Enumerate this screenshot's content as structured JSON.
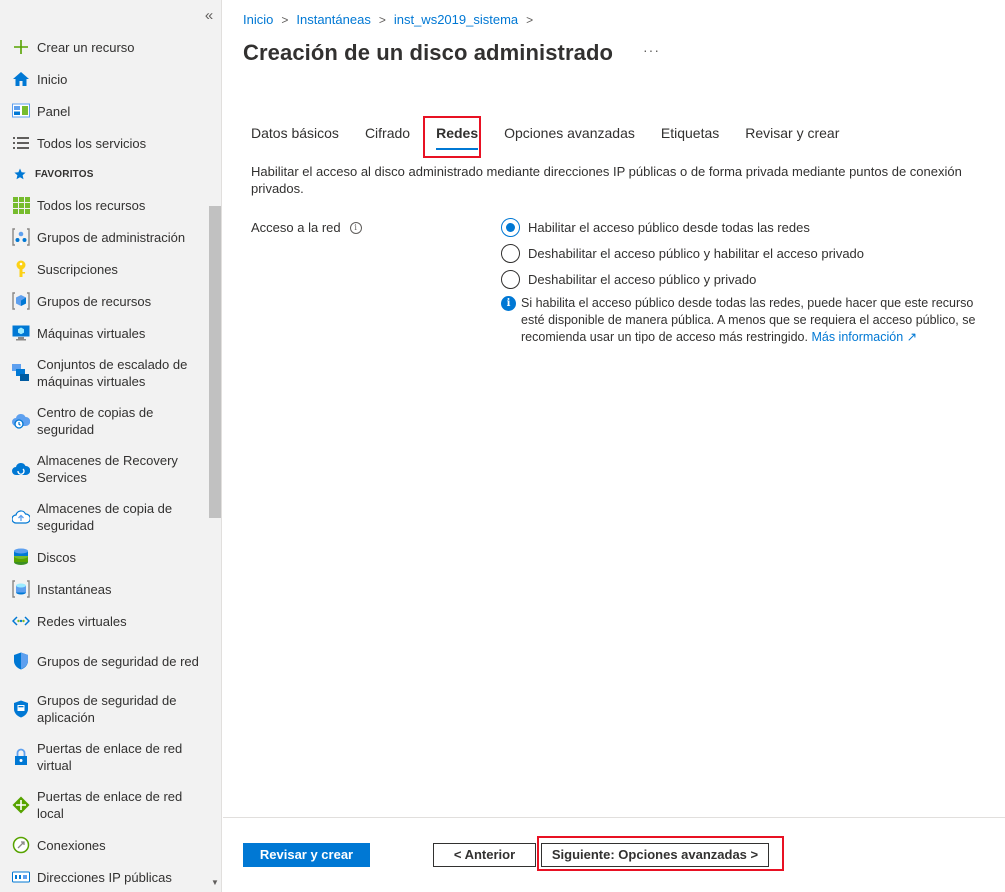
{
  "sidebar": {
    "collapse_symbol": "«",
    "create": {
      "label": "Crear un recurso",
      "icon": "plus-icon"
    },
    "items_top": [
      {
        "label": "Inicio",
        "icon": "home-icon"
      },
      {
        "label": "Panel",
        "icon": "dashboard-icon"
      },
      {
        "label": "Todos los servicios",
        "icon": "list-icon"
      }
    ],
    "favorites_label": "FAVORITOS",
    "favorites": [
      {
        "label": "Todos los recursos",
        "icon": "grid-icon"
      },
      {
        "label": "Grupos de administración",
        "icon": "management-group-icon"
      },
      {
        "label": "Suscripciones",
        "icon": "key-icon"
      },
      {
        "label": "Grupos de recursos",
        "icon": "cube-icon"
      },
      {
        "label": "Máquinas virtuales",
        "icon": "monitor-icon"
      },
      {
        "label": "Conjuntos de escalado de máquinas virtuales",
        "icon": "scale-set-icon"
      },
      {
        "label": "Centro de copias de seguridad",
        "icon": "backup-center-icon"
      },
      {
        "label": "Almacenes de Recovery Services",
        "icon": "recovery-cloud-icon"
      },
      {
        "label": "Almacenes de copia de seguridad",
        "icon": "backup-cloud-icon"
      },
      {
        "label": "Discos",
        "icon": "disk-icon"
      },
      {
        "label": "Instantáneas",
        "icon": "snapshot-icon"
      },
      {
        "label": "Redes virtuales",
        "icon": "vnet-icon"
      },
      {
        "label": "Grupos de seguridad de red",
        "icon": "shield-icon"
      },
      {
        "label": "Grupos de seguridad de aplicación",
        "icon": "app-shield-icon"
      },
      {
        "label": "Puertas de enlace de red virtual",
        "icon": "gateway-lock-icon"
      },
      {
        "label": "Puertas de enlace de red local",
        "icon": "gateway-diamond-icon"
      },
      {
        "label": "Conexiones",
        "icon": "connection-icon"
      },
      {
        "label": "Direcciones IP públicas",
        "icon": "public-ip-icon"
      }
    ]
  },
  "breadcrumb": [
    "Inicio",
    "Instantáneas",
    "inst_ws2019_sistema"
  ],
  "page": {
    "title": "Creación de un disco administrado",
    "more": "···"
  },
  "tabs": [
    "Datos básicos",
    "Cifrado",
    "Redes",
    "Opciones avanzadas",
    "Etiquetas",
    "Revisar y crear"
  ],
  "active_tab": "Redes",
  "description": "Habilitar el acceso al disco administrado mediante direcciones IP públicas o de forma privada mediante puntos de conexión privados.",
  "network_access": {
    "label": "Acceso a la red",
    "info_symbol": "i",
    "options": [
      "Habilitar el acceso público desde todas las redes",
      "Deshabilitar el acceso público y habilitar el acceso privado",
      "Deshabilitar el acceso público y privado"
    ],
    "selected_index": 0,
    "info_message": "Si habilita el acceso público desde todas las redes, puede hacer que este recurso esté disponible de manera pública. A menos que se requiera el acceso público, se recomienda usar un tipo de acceso más restringido.",
    "info_link": "Más información",
    "external_link_symbol": "↗"
  },
  "footer": {
    "review_create": "Revisar y crear",
    "previous": "< Anterior",
    "next": "Siguiente: Opciones avanzadas >"
  },
  "colors": {
    "accent": "#0078d4",
    "highlight": "#e81123",
    "sidebar_bg": "#f2f2f2"
  }
}
